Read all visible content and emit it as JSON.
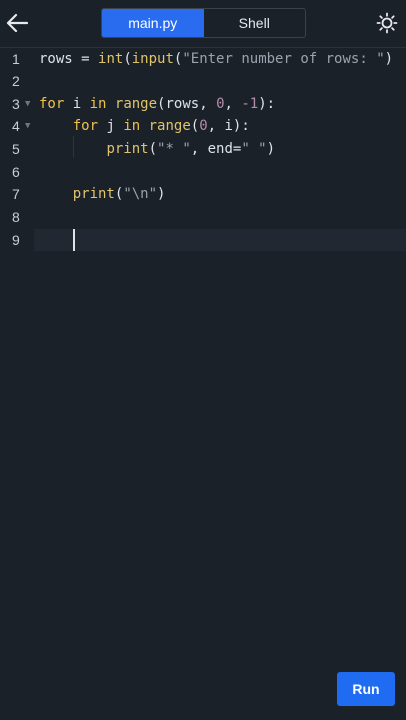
{
  "header": {
    "back_icon": "arrow-left-icon",
    "tabs": [
      {
        "label": "main.py",
        "active": true
      },
      {
        "label": "Shell",
        "active": false
      }
    ],
    "theme_icon": "sun-icon"
  },
  "editor": {
    "line_numbers": [
      "1",
      "2",
      "3",
      "4",
      "5",
      "6",
      "7",
      "8",
      "9"
    ],
    "lines": [
      {
        "tokens": [
          [
            "plain",
            "rows = "
          ],
          [
            "fn",
            "int"
          ],
          [
            "plain",
            "("
          ],
          [
            "fn",
            "input"
          ],
          [
            "plain",
            "("
          ],
          [
            "str",
            "\"Enter number of rows: \""
          ],
          [
            "plain",
            ")"
          ]
        ]
      },
      {
        "tokens": []
      },
      {
        "tokens": [
          [
            "kw",
            "for"
          ],
          [
            "plain",
            " i "
          ],
          [
            "kw",
            "in"
          ],
          [
            "plain",
            " "
          ],
          [
            "fn",
            "range"
          ],
          [
            "plain",
            "(rows, "
          ],
          [
            "num",
            "0"
          ],
          [
            "plain",
            ", "
          ],
          [
            "num",
            "-1"
          ],
          [
            "plain",
            "):"
          ]
        ]
      },
      {
        "tokens": [
          [
            "plain",
            "    "
          ],
          [
            "kw",
            "for"
          ],
          [
            "plain",
            " j "
          ],
          [
            "kw",
            "in"
          ],
          [
            "plain",
            " "
          ],
          [
            "fn",
            "range"
          ],
          [
            "plain",
            "("
          ],
          [
            "num",
            "0"
          ],
          [
            "plain",
            ", i):"
          ]
        ]
      },
      {
        "tokens": [
          [
            "plain",
            "        "
          ],
          [
            "fn",
            "print"
          ],
          [
            "plain",
            "("
          ],
          [
            "str",
            "\"* \""
          ],
          [
            "plain",
            ", end="
          ],
          [
            "str",
            "\" \""
          ],
          [
            "plain",
            ")"
          ]
        ]
      },
      {
        "tokens": []
      },
      {
        "tokens": [
          [
            "plain",
            "    "
          ],
          [
            "fn",
            "print"
          ],
          [
            "plain",
            "("
          ],
          [
            "str",
            "\"\\n\""
          ],
          [
            "plain",
            ")"
          ]
        ]
      },
      {
        "tokens": []
      },
      {
        "tokens": []
      }
    ],
    "active_line": 9
  },
  "run_button": {
    "label": "Run"
  },
  "colors": {
    "accent": "#1f6bf2",
    "background": "#1b2129",
    "keyword": "#f0c14d",
    "number": "#b48ead"
  }
}
